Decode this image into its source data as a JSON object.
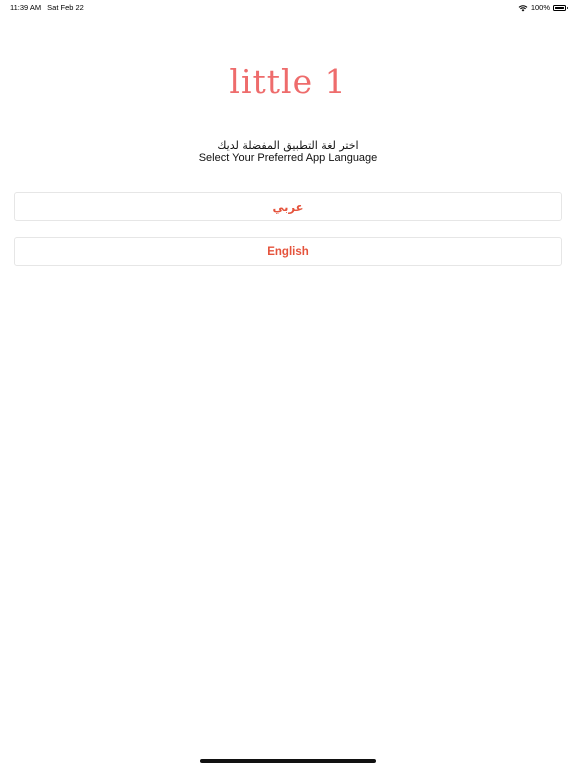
{
  "status_bar": {
    "time": "11:39 AM",
    "date": "Sat Feb 22",
    "battery_text": "100%",
    "battery_level": 1.0,
    "wifi_icon": "wifi-icon",
    "battery_icon": "battery-icon"
  },
  "logo": {
    "text": "little 1",
    "color": "#ee6c6c"
  },
  "prompt": {
    "arabic": "اختر لغة التطبيق المفضلة لديك",
    "english": "Select Your Preferred App Language"
  },
  "languages": {
    "arabic_label": "عربي",
    "english_label": "English",
    "accent_color": "#e5533c"
  }
}
